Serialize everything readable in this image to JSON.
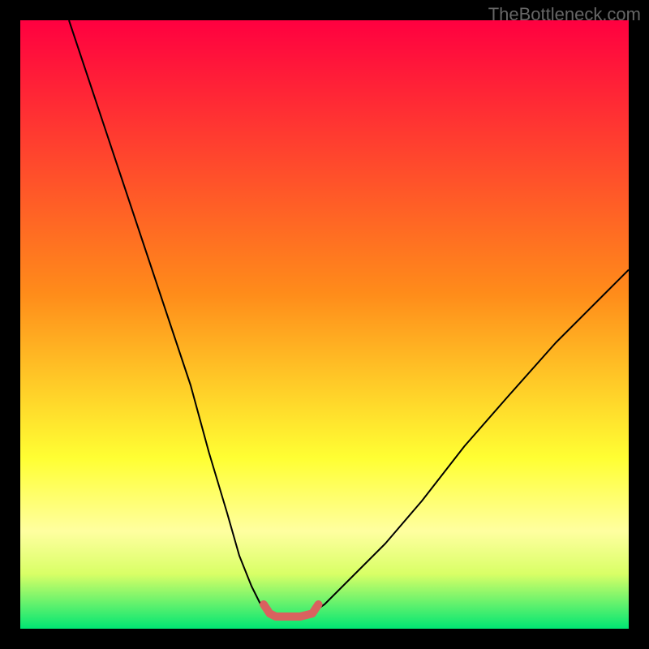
{
  "watermark": "TheBottleneck.com",
  "chart_data": {
    "type": "line",
    "title": "",
    "xlabel": "",
    "ylabel": "",
    "xlim": [
      0,
      100
    ],
    "ylim": [
      0,
      100
    ],
    "gradient_stops": [
      {
        "offset": 0,
        "color": "#ff0040"
      },
      {
        "offset": 45,
        "color": "#ff8c1a"
      },
      {
        "offset": 72,
        "color": "#ffff33"
      },
      {
        "offset": 84,
        "color": "#ffffa0"
      },
      {
        "offset": 91,
        "color": "#d9ff66"
      },
      {
        "offset": 100,
        "color": "#00e673"
      }
    ],
    "series": [
      {
        "name": "curve-left",
        "type": "line",
        "x": [
          8,
          12,
          16,
          20,
          24,
          28,
          31,
          34,
          36,
          38,
          39.5,
          40.5
        ],
        "values": [
          100,
          88,
          76,
          64,
          52,
          40,
          29,
          19,
          12,
          7,
          4,
          3
        ],
        "stroke": "#000000",
        "width": 2
      },
      {
        "name": "curve-right",
        "type": "line",
        "x": [
          48.5,
          50,
          52,
          55,
          60,
          66,
          73,
          80,
          88,
          96,
          100
        ],
        "values": [
          3,
          4,
          6,
          9,
          14,
          21,
          30,
          38,
          47,
          55,
          59
        ],
        "stroke": "#000000",
        "width": 2
      },
      {
        "name": "bottom-highlight",
        "type": "line",
        "x": [
          40,
          41,
          42,
          44,
          46,
          48,
          49
        ],
        "values": [
          4,
          2.5,
          2,
          2,
          2,
          2.5,
          4
        ],
        "stroke": "#d9625f",
        "width": 10,
        "linecap": "round"
      }
    ]
  }
}
